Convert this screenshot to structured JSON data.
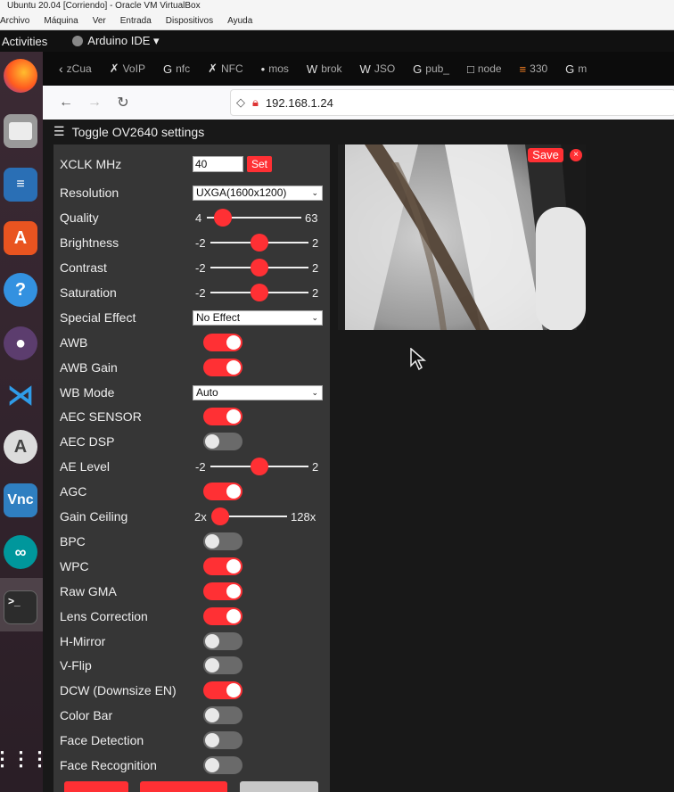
{
  "window": {
    "title": "Ubuntu 20.04 [Corriendo] - Oracle VM VirtualBox"
  },
  "vbox_menu": [
    "Archivo",
    "Máquina",
    "Ver",
    "Entrada",
    "Dispositivos",
    "Ayuda"
  ],
  "gnome": {
    "activities": "Activities",
    "app_name": "Arduino IDE ▾"
  },
  "dock": [
    "firefox-icon",
    "files-icon",
    "writer-icon",
    "software-icon",
    "help-icon",
    "github-icon",
    "vscode-icon",
    "updater-icon",
    "vnc-icon",
    "arduino-icon",
    "terminal-icon",
    "apps-grid-icon"
  ],
  "tabs": [
    {
      "icon": "‹",
      "label": "zCua"
    },
    {
      "icon": "✗",
      "label": "VoIP"
    },
    {
      "icon": "G",
      "label": "nfc"
    },
    {
      "icon": "✗",
      "label": "NFC"
    },
    {
      "icon": "•",
      "label": "mos"
    },
    {
      "icon": "W",
      "label": "brok"
    },
    {
      "icon": "W",
      "label": "JSO"
    },
    {
      "icon": "G",
      "label": "pub_"
    },
    {
      "icon": "□",
      "label": "node"
    },
    {
      "icon": "≡",
      "label": "330"
    },
    {
      "icon": "G",
      "label": "m"
    }
  ],
  "navbar": {
    "url": "192.168.1.24"
  },
  "page": {
    "toggle_label": "Toggle OV2640 settings",
    "save_label": "Save",
    "close_label": "×"
  },
  "settings": {
    "xclk": {
      "label": "XCLK MHz",
      "value": "40",
      "button": "Set"
    },
    "resolution": {
      "label": "Resolution",
      "value": "UXGA(1600x1200)"
    },
    "quality": {
      "label": "Quality",
      "min": "4",
      "max": "63",
      "value": 10
    },
    "brightness": {
      "label": "Brightness",
      "min": "-2",
      "max": "2",
      "value": 0
    },
    "contrast": {
      "label": "Contrast",
      "min": "-2",
      "max": "2",
      "value": 0
    },
    "saturation": {
      "label": "Saturation",
      "min": "-2",
      "max": "2",
      "value": 0
    },
    "special_effect": {
      "label": "Special Effect",
      "value": "No Effect"
    },
    "awb": {
      "label": "AWB",
      "on": true
    },
    "awb_gain": {
      "label": "AWB Gain",
      "on": true
    },
    "wb_mode": {
      "label": "WB Mode",
      "value": "Auto"
    },
    "aec_sensor": {
      "label": "AEC SENSOR",
      "on": true
    },
    "aec_dsp": {
      "label": "AEC DSP",
      "on": false
    },
    "ae_level": {
      "label": "AE Level",
      "min": "-2",
      "max": "2",
      "value": 0
    },
    "agc": {
      "label": "AGC",
      "on": true
    },
    "gain_ceiling": {
      "label": "Gain Ceiling",
      "min": "2x",
      "max": "128x",
      "value": 0
    },
    "bpc": {
      "label": "BPC",
      "on": false
    },
    "wpc": {
      "label": "WPC",
      "on": true
    },
    "raw_gma": {
      "label": "Raw GMA",
      "on": true
    },
    "lens_correction": {
      "label": "Lens Correction",
      "on": true
    },
    "h_mirror": {
      "label": "H-Mirror",
      "on": false
    },
    "v_flip": {
      "label": "V-Flip",
      "on": false
    },
    "dcw": {
      "label": "DCW (Downsize EN)",
      "on": true
    },
    "color_bar": {
      "label": "Color Bar",
      "on": false
    },
    "face_detection": {
      "label": "Face Detection",
      "on": false
    },
    "face_recognition": {
      "label": "Face Recognition",
      "on": false
    }
  },
  "colors": {
    "accent": "#ff3034",
    "panel": "#363636",
    "page_bg": "#181818"
  }
}
